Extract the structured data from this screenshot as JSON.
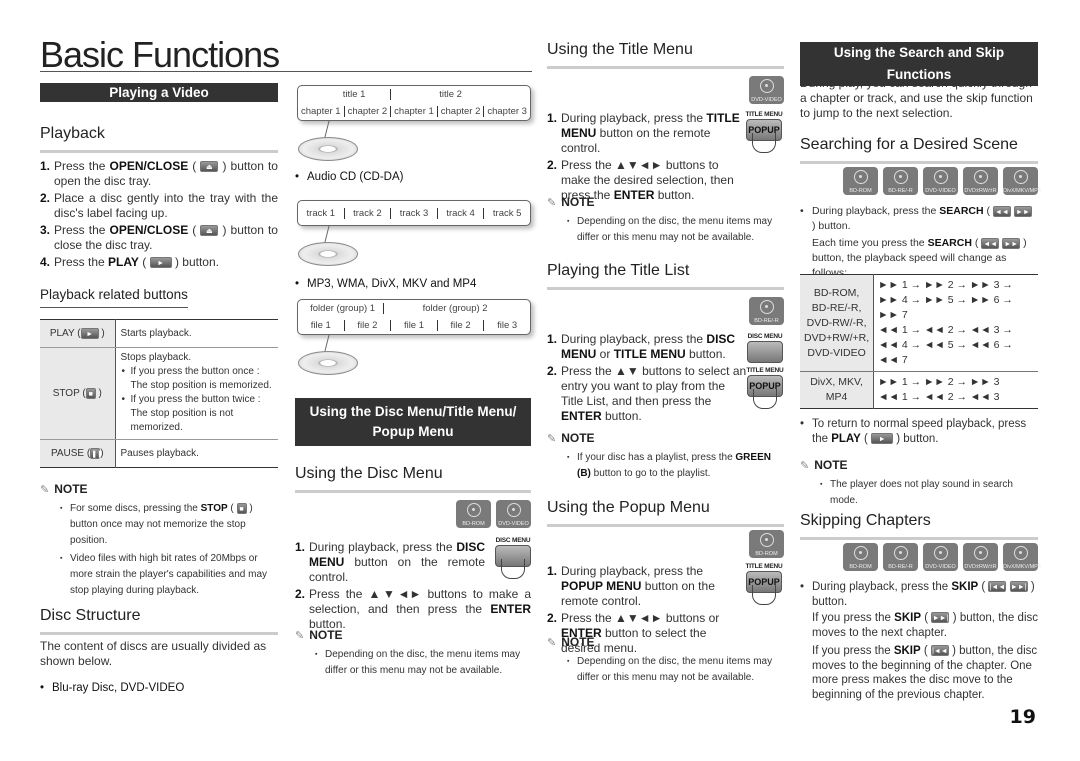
{
  "page": {
    "title": "Basic Functions",
    "page_number": "19"
  },
  "col1": {
    "section_bar": "Playing a Video",
    "playback": {
      "heading": "Playback",
      "steps": [
        {
          "num": "1.",
          "pre": "Press the ",
          "bold": "OPEN/CLOSE",
          "icon": "eject-icon",
          "icon_glyph": "⏏",
          "post": " button to open the disc tray."
        },
        {
          "num": "2.",
          "text": "Place a disc gently into the tray with the disc's label facing up."
        },
        {
          "num": "3.",
          "pre": "Press the ",
          "bold": "OPEN/CLOSE",
          "icon": "eject-icon",
          "icon_glyph": "⏏",
          "post": " button to close the disc tray."
        },
        {
          "num": "4.",
          "pre": "Press the ",
          "bold": "PLAY",
          "icon": "play-icon",
          "icon_glyph": "►",
          "post": " button."
        }
      ]
    },
    "related": {
      "heading": "Playback related buttons",
      "rows": [
        {
          "key": "PLAY (",
          "icon": "play-icon",
          "glyph": "►",
          "desc": "Starts playback.",
          "bullets": []
        },
        {
          "key": "STOP (",
          "icon": "stop-icon",
          "glyph": "■",
          "desc": "Stops playback.",
          "bullets": [
            "If you press the button once : The stop position is memorized.",
            "If you press the button twice : The stop position is not memorized."
          ]
        },
        {
          "key": "PAUSE (",
          "icon": "pause-icon",
          "glyph": "❚❚",
          "desc": "Pauses playback.",
          "bullets": []
        }
      ]
    },
    "note": {
      "label": "NOTE",
      "items": [
        {
          "pre": "For some discs, pressing the ",
          "bold": "STOP",
          "glyph": "■",
          "post": " button once may not memorize the stop position."
        },
        {
          "text": "Video files with high bit rates of 20Mbps or more strain the player's capabilities and may stop playing during playback."
        }
      ]
    },
    "disc_structure": {
      "heading": "Disc Structure",
      "text": "The content of discs are usually divided as shown below.",
      "bullet": "Blu-ray Disc, DVD-VIDEO"
    }
  },
  "col2": {
    "diagram1": {
      "row1": [
        "title 1",
        "title 2"
      ],
      "row2": [
        "chapter 1",
        "chapter 2",
        "chapter 1",
        "chapter 2",
        "chapter 3"
      ]
    },
    "bullet_audio": "Audio CD (CD-DA)",
    "diagram2": {
      "row1": [
        "track 1",
        "track 2",
        "track 3",
        "track 4",
        "track 5"
      ]
    },
    "bullet_files": "MP3, WMA, DivX, MKV and MP4",
    "diagram3": {
      "row1": [
        "folder (group) 1",
        "folder (group) 2"
      ],
      "row2": [
        "file 1",
        "file 2",
        "file 1",
        "file 2",
        "file 3"
      ]
    },
    "section_bar_line1": "Using the Disc Menu/Title Menu/",
    "section_bar_line2": "Popup Menu",
    "disc_menu": {
      "heading": "Using the Disc Menu",
      "disc_icons": [
        "BD-ROM",
        "DVD-VIDEO"
      ],
      "remote_label": "DISC MENU",
      "steps": [
        {
          "num": "1.",
          "pre": "During playback, press the ",
          "bold": "DISC MENU",
          "post": " button on the remote control."
        },
        {
          "num": "2.",
          "pre": "Press the ▲▼◄► buttons to make a selection, and then press the ",
          "bold": "ENTER",
          "post": " button."
        }
      ],
      "note_label": "NOTE",
      "note": "Depending on the disc, the menu items may differ or this menu may not be available."
    }
  },
  "col3": {
    "title_menu": {
      "heading": "Using the Title Menu",
      "disc_icons": [
        "DVD-VIDEO"
      ],
      "remote_label": "TITLE MENU",
      "remote_button": "POPUP",
      "steps": [
        {
          "num": "1.",
          "pre": "During playback, press the ",
          "bold": "TITLE MENU",
          "post": " button on the remote control."
        },
        {
          "num": "2.",
          "pre": "Press the ▲▼◄► buttons to make the desired selection, then press the ",
          "bold": "ENTER",
          "post": " button."
        }
      ],
      "note_label": "NOTE",
      "note": "Depending on the disc, the menu items may differ or this menu may not be available."
    },
    "title_list": {
      "heading": "Playing the Title List",
      "disc_icons": [
        "BD-RE/-R"
      ],
      "remote_label1": "DISC MENU",
      "remote_label2": "TITLE MENU",
      "remote_button": "POPUP",
      "steps": [
        {
          "num": "1.",
          "pre": "During playback, press the ",
          "bold": "DISC MENU",
          "mid": " or ",
          "bold2": "TITLE MENU",
          "post": " button."
        },
        {
          "num": "2.",
          "pre": "Press the ▲▼ buttons to select an entry you want to play from the Title List, and then press the ",
          "bold": "ENTER",
          "post": " button."
        }
      ],
      "note_label": "NOTE",
      "note_pre": "If your disc has a playlist, press the ",
      "note_bold": "GREEN (B)",
      "note_post": " button to go to the playlist."
    },
    "popup_menu": {
      "heading": "Using the Popup Menu",
      "disc_icons": [
        "BD-ROM"
      ],
      "remote_label": "TITLE MENU",
      "remote_button": "POPUP",
      "steps": [
        {
          "num": "1.",
          "pre": "During playback, press the ",
          "bold": "POPUP MENU",
          "post": " button on the remote control."
        },
        {
          "num": "2.",
          "pre": "Press the ▲▼◄► buttons or ",
          "bold": "ENTER",
          "post": " button to select the desired menu."
        }
      ],
      "note_label": "NOTE",
      "note": "Depending on the disc, the menu items may differ or this menu may not be available."
    }
  },
  "col4": {
    "section_bar": "Using the Search and Skip Functions",
    "intro": "During play, you can search quickly through a chapter or track, and use the skip function to jump to the next selection.",
    "search": {
      "heading": "Searching for a Desired Scene",
      "disc_icons": [
        "BD-ROM",
        "BD-RE/-R",
        "DVD-VIDEO",
        "DVD±RW/±R",
        "DivX/MKV/MP4"
      ],
      "bullet_pre": "During playback, press the ",
      "bullet_bold": "SEARCH",
      "bullet_post": " button.",
      "each_pre": "Each time you press the ",
      "each_bold": "SEARCH",
      "each_post": " button, the playback speed will change as follows:",
      "table": [
        {
          "key": "BD-ROM, BD-RE/-R, DVD-RW/-R, DVD+RW/+R, DVD-VIDEO",
          "lines": [
            "►► 1 → ►► 2 → ►► 3 →",
            "►► 4 → ►► 5 → ►► 6 → ►► 7",
            "◄◄ 1 → ◄◄ 2 → ◄◄ 3 →",
            "◄◄ 4 → ◄◄ 5 → ◄◄ 6 → ◄◄ 7"
          ]
        },
        {
          "key": "DivX, MKV, MP4",
          "lines": [
            "►► 1 → ►► 2 → ►► 3",
            "◄◄ 1 → ◄◄ 2 → ◄◄ 3"
          ]
        }
      ],
      "return_pre": "To return to normal speed playback, press the ",
      "return_bold": "PLAY",
      "return_post": " button.",
      "note_label": "NOTE",
      "note": "The player does not play sound in search mode."
    },
    "skip": {
      "heading": "Skipping Chapters",
      "disc_icons": [
        "BD-ROM",
        "BD-RE/-R",
        "DVD-VIDEO",
        "DVD±RW/±R",
        "DivX/MKV/MP4"
      ],
      "bullet_pre": "During playback, press the ",
      "bullet_bold": "SKIP",
      "bullet_post": " button.",
      "next_pre": "If you press the ",
      "next_bold": "SKIP",
      "next_post": " button, the disc moves to the next chapter.",
      "prev_pre": "If you press the ",
      "prev_bold": "SKIP",
      "prev_post": " button, the disc moves to the beginning of the chapter. One more press makes the disc move to the beginning of the previous chapter."
    }
  }
}
